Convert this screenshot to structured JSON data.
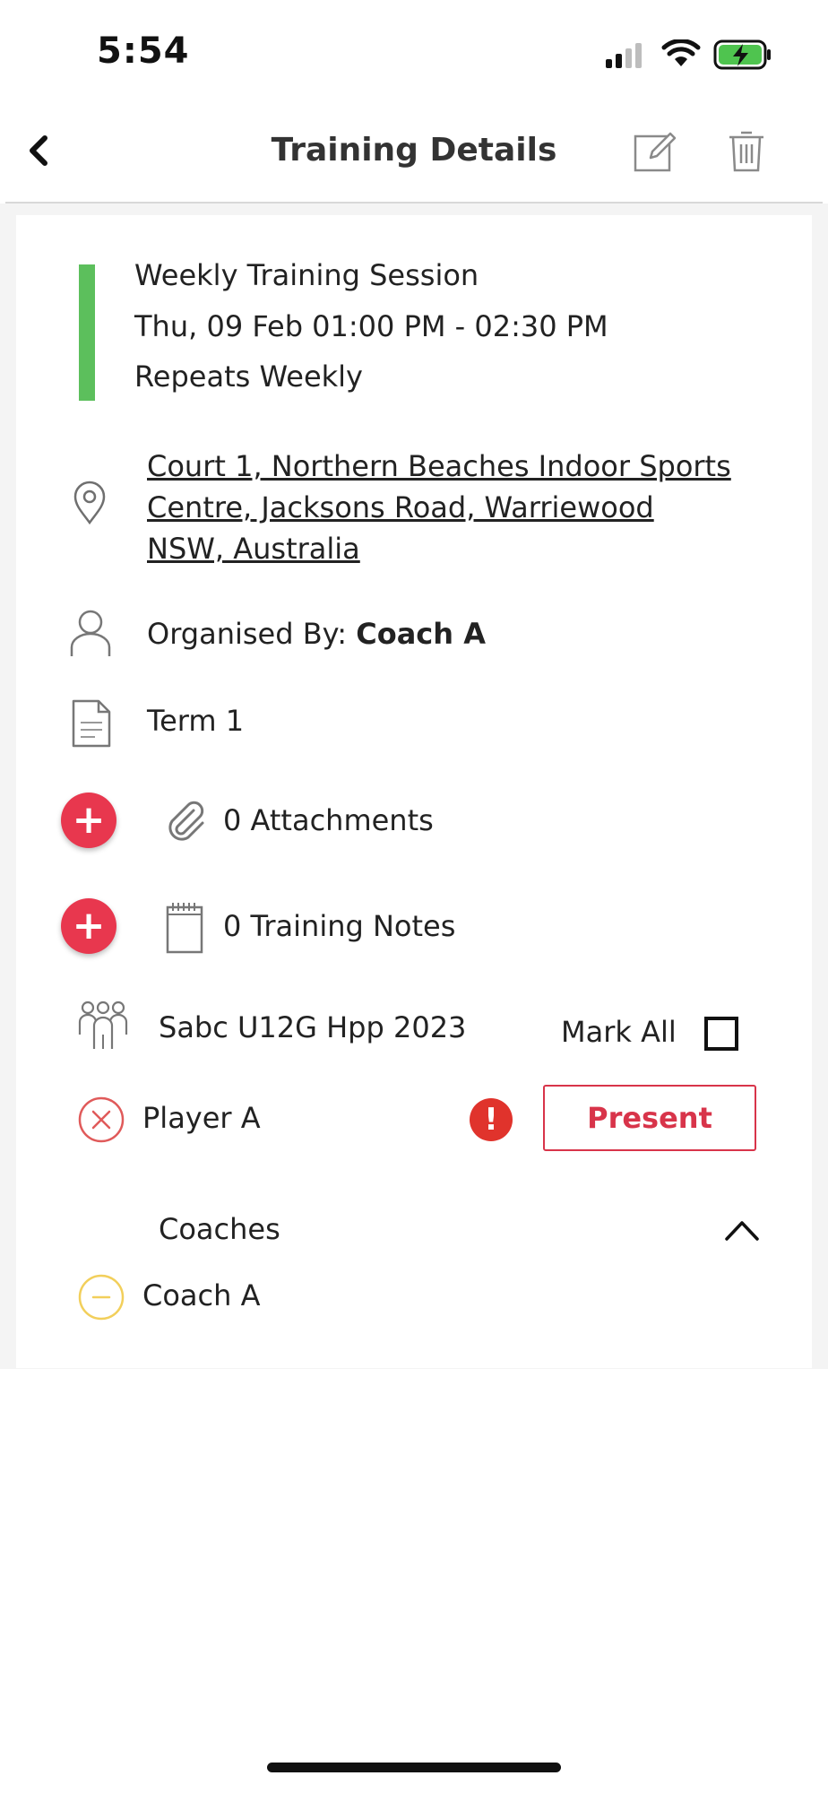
{
  "status_bar": {
    "time": "5:54"
  },
  "header": {
    "title": "Training Details"
  },
  "event": {
    "title": "Weekly Training Session",
    "datetime": "Thu, 09 Feb 01:00 PM - 02:30 PM",
    "repeat": "Repeats Weekly",
    "color": "#5cbf5c"
  },
  "location": {
    "address": "Court 1, Northern Beaches Indoor Sports Centre, Jacksons Road, Warriewood NSW, Australia"
  },
  "organiser": {
    "label": "Organised By: ",
    "name": "Coach A"
  },
  "term": {
    "label": "Term 1"
  },
  "attachments": {
    "add_symbol": "+",
    "label": "0 Attachments"
  },
  "notes": {
    "add_symbol": "+",
    "label": "0 Training Notes"
  },
  "team": {
    "name": "Sabc U12G Hpp 2023",
    "mark_all_label": "Mark All"
  },
  "players": [
    {
      "name": "Player A",
      "status_icon": "x-circle-icon",
      "alert_symbol": "!",
      "action_label": "Present"
    }
  ],
  "coaches": {
    "section_label": "Coaches",
    "items": [
      {
        "name": "Coach A",
        "status_icon": "minus-circle-icon"
      }
    ]
  },
  "colors": {
    "accent": "#e8374e",
    "present": "#d8344a",
    "absent_icon": "#e05a5a",
    "pending_icon": "#f2cf5b"
  }
}
